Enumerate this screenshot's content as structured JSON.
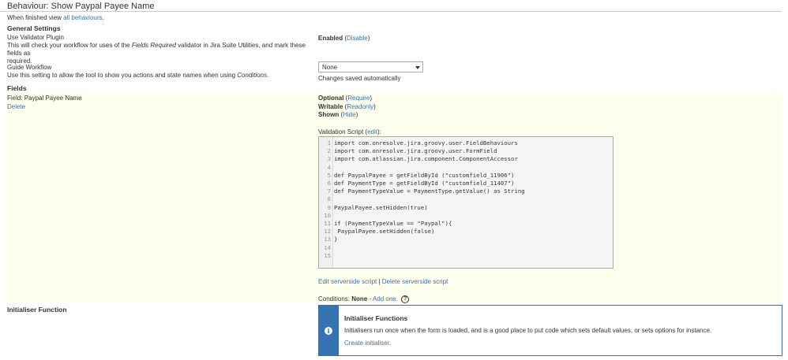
{
  "header": {
    "title": "Behaviour: Show Paypal Payee Name"
  },
  "nav": {
    "finished_text": "When finished view ",
    "all_behaviours_link": "all behaviours",
    "finished_suffix": "."
  },
  "general_settings": {
    "heading": "General Settings",
    "validator": {
      "label": "Use Validator Plugin",
      "desc_pre": "This will check your workflow for uses of the ",
      "desc_em": "Fields Required",
      "desc_post": " validator in Jira Suite Utilities, and mark these fields as",
      "desc_line2": "required.",
      "status": "Enabled",
      "action": "Disable"
    },
    "guide": {
      "label": "Guide Workflow",
      "desc_pre": "Use this setting to allow the tool to show you actions and state names when using ",
      "desc_em": "Conditions",
      "desc_post": ".",
      "select_value": "None",
      "saved_text": "Changes saved automatically"
    }
  },
  "fields": {
    "heading": "Fields",
    "field_name": "Field: Paypal Payee Name",
    "delete_link": "Delete",
    "optional": {
      "label": "Optional",
      "action": "Require"
    },
    "writable": {
      "label": "Writable",
      "action": "Readonly"
    },
    "shown": {
      "label": "Shown",
      "action": "Hide"
    },
    "validation_label": "Validation Script",
    "validation_edit": "edit",
    "code_lines": [
      "import com.onresolve.jira.groovy.user.FieldBehaviours",
      "import com.onresolve.jira.groovy.user.FormField",
      "import com.atlassian.jira.component.ComponentAccessor",
      "",
      "def PaypalPayee = getFieldById (\"customfield_11906\")",
      "def PaymentType = getFieldById (\"customfield_11407\")",
      "def PaymentTypeValue = PaymentType.getValue() as String",
      "",
      "PaypalPayee.setHidden(true)",
      "",
      "if (PaymentTypeValue == \"Paypal\"){",
      " PaypalPayee.setHidden(false)",
      "}",
      "",
      ""
    ],
    "edit_serverside": "Edit serverside script",
    "separator": "|",
    "delete_serverside": "Delete serverside script",
    "conditions_label": "Conditions:",
    "conditions_value": "None",
    "conditions_dash": "-",
    "add_one": "Add one."
  },
  "initialiser": {
    "heading": "Initialiser Function",
    "box_title": "Initialiser Functions",
    "box_text": "Initialisers run once when the form is loaded, and is a good place to put code which sets default values, or sets options for instance.",
    "create_link": "Create initialiser."
  }
}
